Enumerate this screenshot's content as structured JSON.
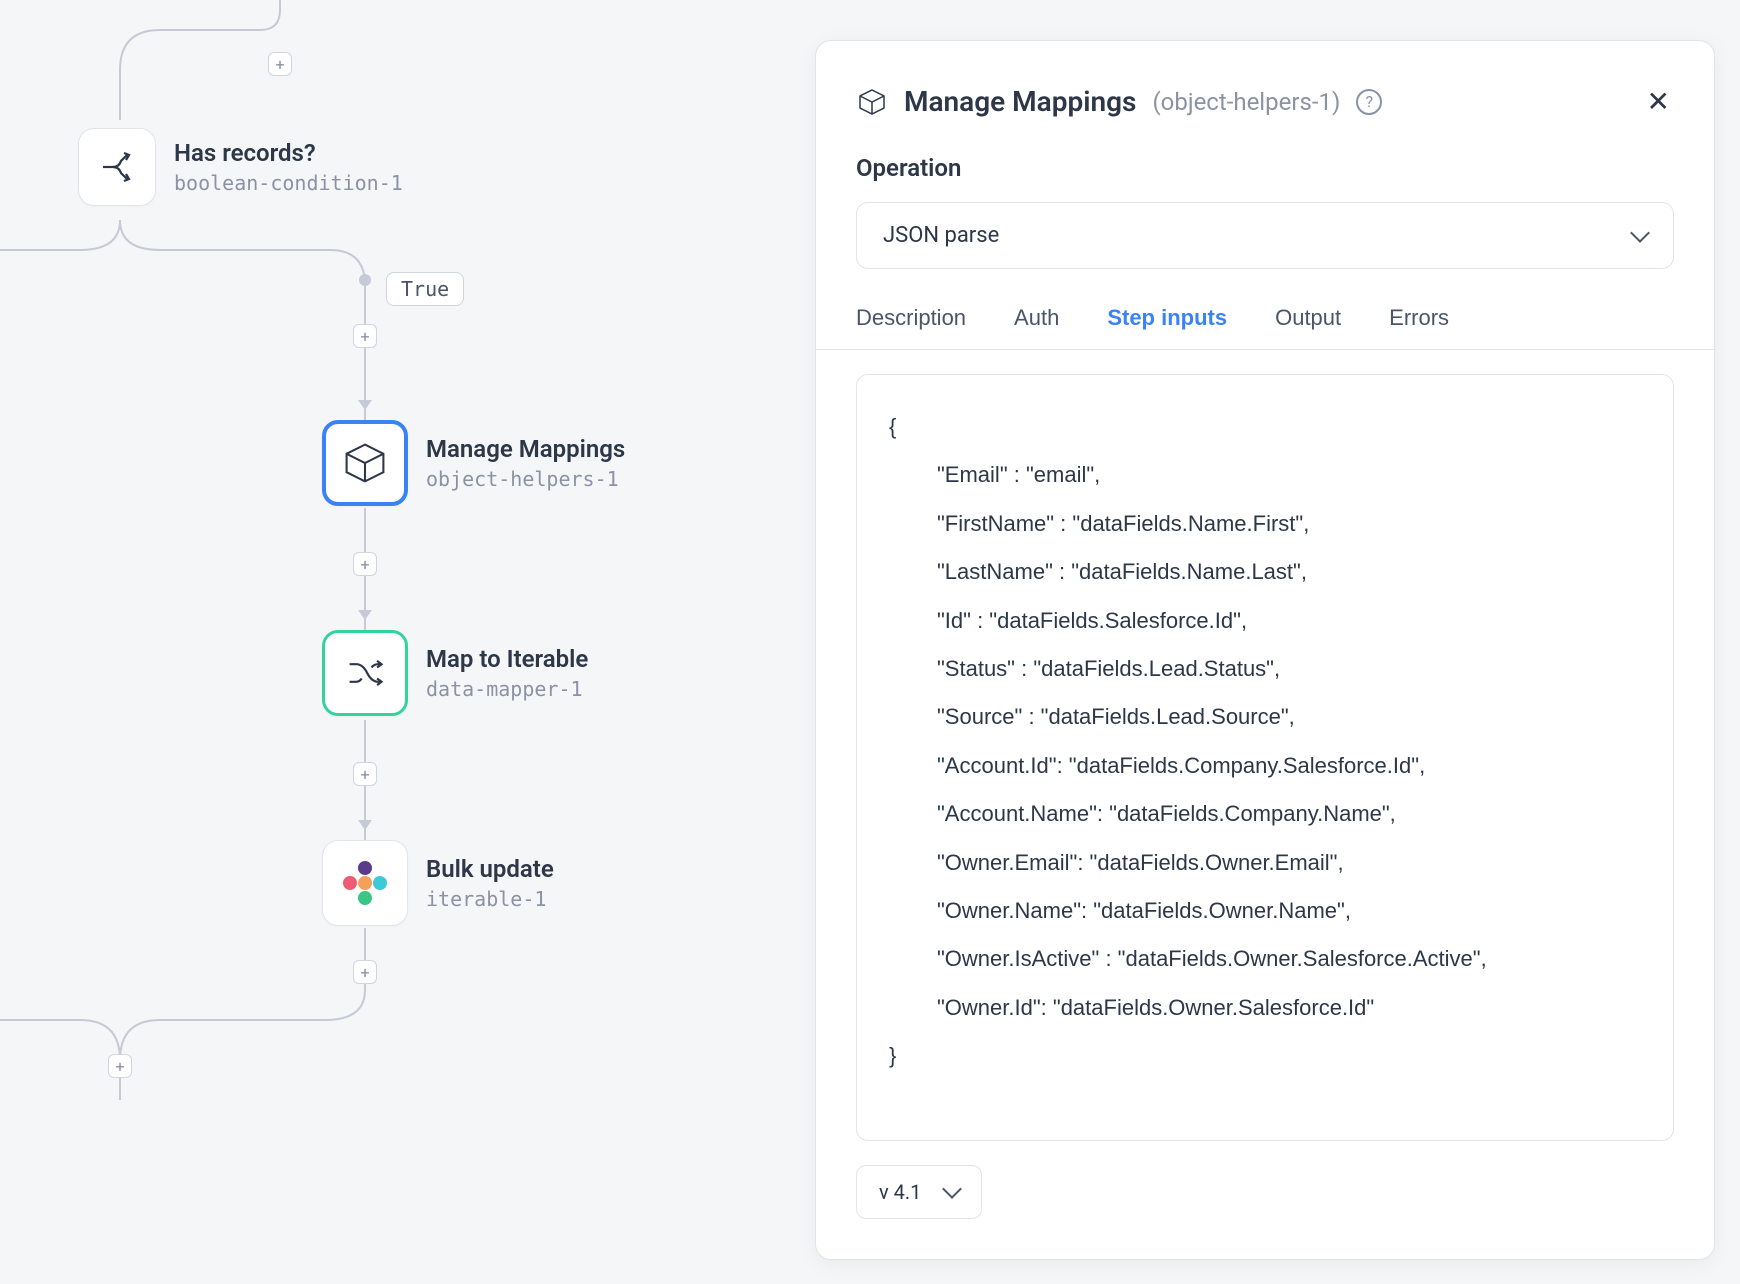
{
  "canvas": {
    "branch_label": "True",
    "nodes": [
      {
        "title": "Has records?",
        "subtitle": "boolean-condition-1"
      },
      {
        "title": "Manage Mappings",
        "subtitle": "object-helpers-1"
      },
      {
        "title": "Map to Iterable",
        "subtitle": "data-mapper-1"
      },
      {
        "title": "Bulk update",
        "subtitle": "iterable-1"
      }
    ]
  },
  "panel": {
    "title": "Manage Mappings",
    "subtitle": "(object-helpers-1)",
    "operation_label": "Operation",
    "operation_value": "JSON parse",
    "tabs": {
      "description": "Description",
      "auth": "Auth",
      "step_inputs": "Step inputs",
      "output": "Output",
      "errors": "Errors"
    },
    "code_lines": [
      "\"Email\" : \"email\",",
      "\"FirstName\" :  \"dataFields.Name.First\",",
      "\"LastName\" : \"dataFields.Name.Last\",",
      "\"Id\" : \"dataFields.Salesforce.Id\",",
      "\"Status\" : \"dataFields.Lead.Status\",",
      "\"Source\" : \"dataFields.Lead.Source\",",
      "\"Account.Id\": \"dataFields.Company.Salesforce.Id\",",
      "\"Account.Name\": \"dataFields.Company.Name\",",
      "\"Owner.Email\": \"dataFields.Owner.Email\",",
      "\"Owner.Name\": \"dataFields.Owner.Name\",",
      "\"Owner.IsActive\" : \"dataFields.Owner.Salesforce.Active\",",
      "\"Owner.Id\": \"dataFields.Owner.Salesforce.Id\""
    ],
    "version": "v 4.1"
  }
}
